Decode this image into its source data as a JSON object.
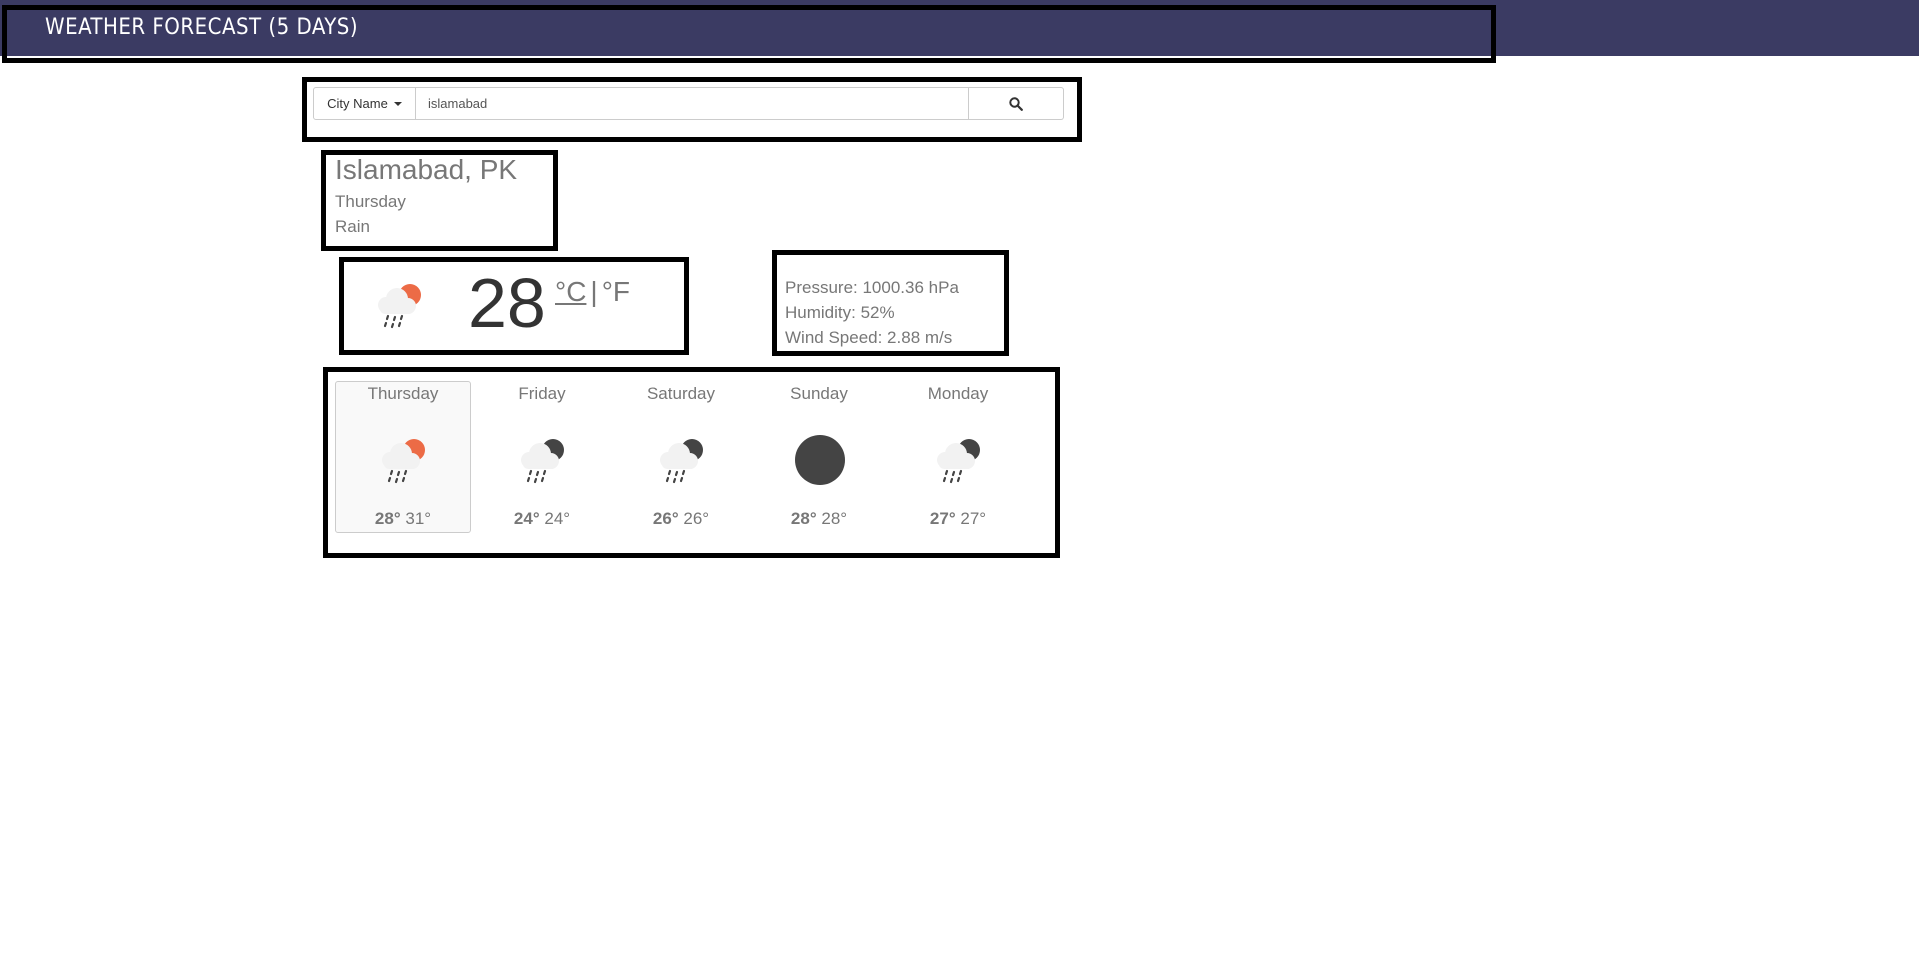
{
  "header": {
    "title": "WEATHER FORECAST (5 DAYS)"
  },
  "search": {
    "mode_label": "City Name",
    "query": "islamabad",
    "search_icon": "search-icon"
  },
  "location": {
    "city": "Islamabad, PK",
    "day": "Thursday",
    "condition": "Rain"
  },
  "current": {
    "temperature": "28",
    "unit_c": "°C",
    "unit_sep": "|",
    "unit_f": "°F",
    "icon": "rain-day-icon"
  },
  "details": {
    "pressure": "Pressure: 1000.36 hPa",
    "humidity": "Humidity: 52%",
    "wind_speed": "Wind Speed: 2.88 m/s"
  },
  "forecast": [
    {
      "day": "Thursday",
      "icon": "rain-day-icon",
      "high": "28",
      "low": "31",
      "selected": true
    },
    {
      "day": "Friday",
      "icon": "rain-night-icon",
      "high": "24",
      "low": "24",
      "selected": false
    },
    {
      "day": "Saturday",
      "icon": "rain-night-icon",
      "high": "26",
      "low": "26",
      "selected": false
    },
    {
      "day": "Sunday",
      "icon": "moon-icon",
      "high": "28",
      "low": "28",
      "selected": false
    },
    {
      "day": "Monday",
      "icon": "rain-night-icon",
      "high": "27",
      "low": "27",
      "selected": false
    }
  ],
  "degree_symbol": "°",
  "colors": {
    "header_bg": "#3b3b63",
    "sun_orange": "#ec6b46",
    "moon_dark": "#444444"
  }
}
